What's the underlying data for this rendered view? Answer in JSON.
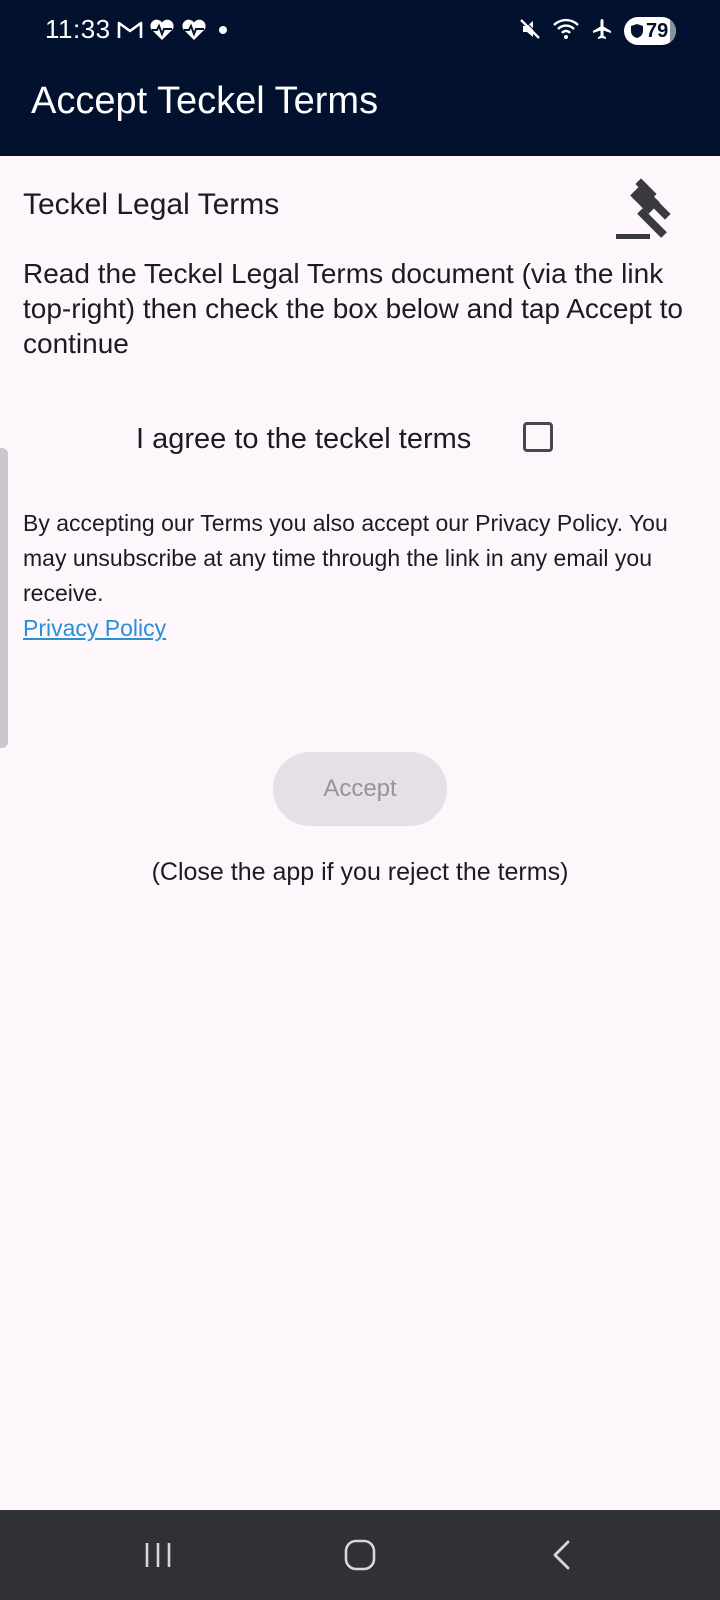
{
  "status_bar": {
    "time": "11:33",
    "battery_percent": "79",
    "notification_icons": [
      "gmail-icon",
      "health-icon",
      "health-icon",
      "dot-icon"
    ],
    "system_icons": [
      "mute-icon",
      "wifi-icon",
      "airplane-icon",
      "battery-icon"
    ]
  },
  "app_bar": {
    "title": "Accept Teckel Terms"
  },
  "terms": {
    "section_title": "Teckel Legal Terms",
    "document_link_icon": "gavel-icon",
    "instructions": "Read the Teckel Legal Terms document (via the link top-right) then check the box below and tap Accept to continue",
    "agree_label": "I agree to the teckel terms",
    "agree_checked": false,
    "privacy_text": "By accepting our Terms you also accept our Privacy Policy. You may unsubscribe at any time through the link in any email you receive.",
    "privacy_link": "Privacy Policy",
    "accept_label": "Accept",
    "accept_enabled": false,
    "reject_note": "(Close the app if you reject the terms)"
  },
  "nav_bar": {
    "buttons": [
      "recents-icon",
      "home-icon",
      "back-icon"
    ]
  },
  "colors": {
    "app_bar": "#02112d",
    "background": "#fdf7fc",
    "link": "#2a8fd6",
    "button_disabled_bg": "#e5e0e6",
    "nav_bar": "#313035"
  }
}
